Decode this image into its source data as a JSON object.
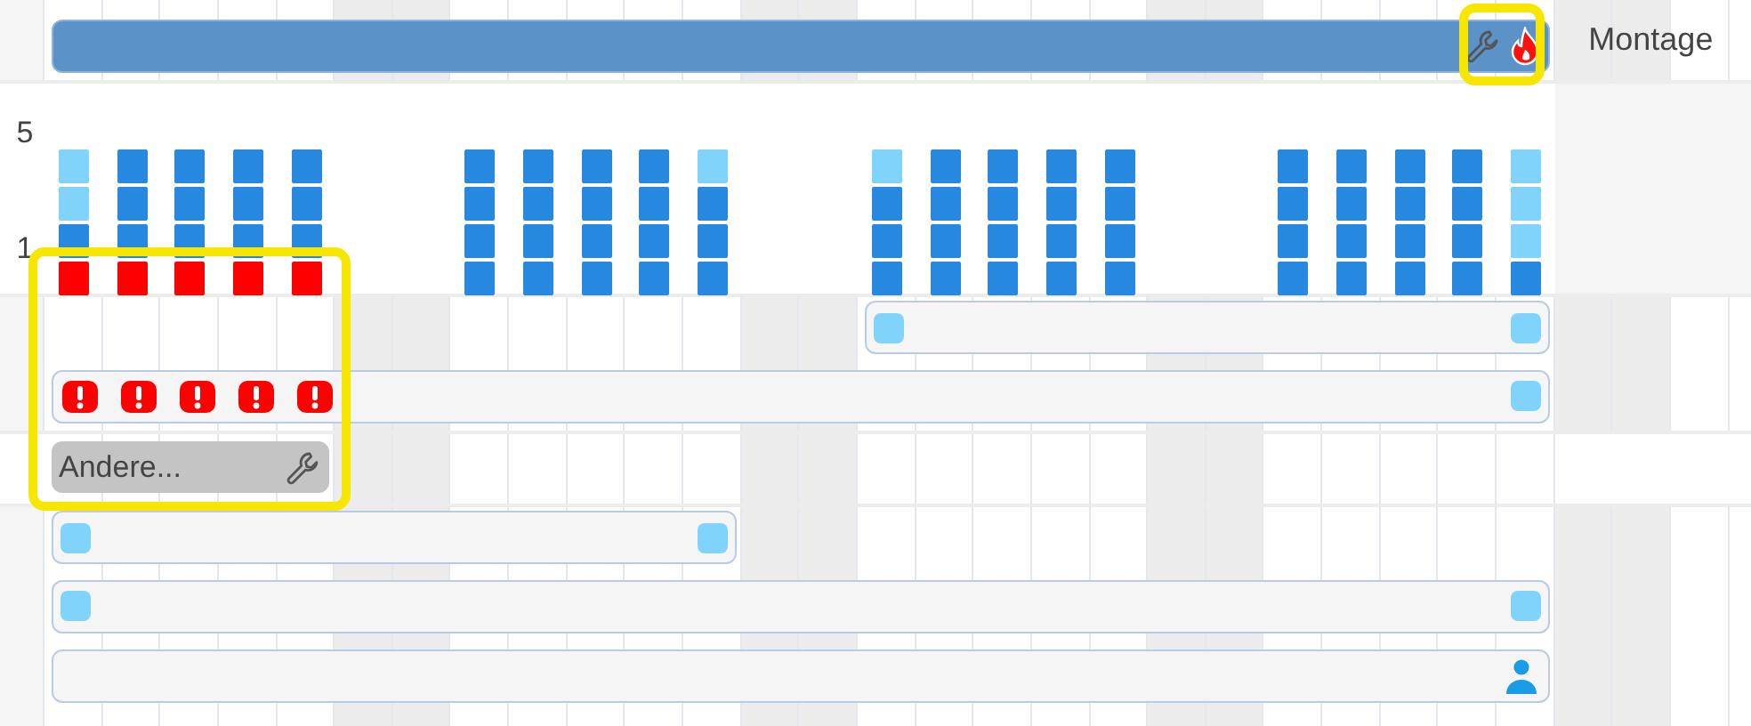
{
  "axis_labels": [
    "5",
    "1"
  ],
  "days": [
    {
      "weekend": false,
      "load": [
        {
          "kind": "free"
        },
        {
          "kind": "free"
        },
        {
          "kind": "booked"
        },
        {
          "kind": "over"
        }
      ]
    },
    {
      "weekend": false,
      "load": [
        {
          "kind": "booked"
        },
        {
          "kind": "booked"
        },
        {
          "kind": "booked"
        },
        {
          "kind": "over"
        }
      ]
    },
    {
      "weekend": false,
      "load": [
        {
          "kind": "booked"
        },
        {
          "kind": "booked"
        },
        {
          "kind": "booked"
        },
        {
          "kind": "over"
        }
      ]
    },
    {
      "weekend": false,
      "load": [
        {
          "kind": "booked"
        },
        {
          "kind": "booked"
        },
        {
          "kind": "booked"
        },
        {
          "kind": "over"
        }
      ]
    },
    {
      "weekend": false,
      "load": [
        {
          "kind": "booked"
        },
        {
          "kind": "booked"
        },
        {
          "kind": "booked"
        },
        {
          "kind": "over"
        }
      ]
    },
    {
      "weekend": true
    },
    {
      "weekend": true
    },
    {
      "weekend": false,
      "load": [
        {
          "kind": "booked"
        },
        {
          "kind": "booked"
        },
        {
          "kind": "booked"
        },
        {
          "kind": "booked"
        }
      ]
    },
    {
      "weekend": false,
      "load": [
        {
          "kind": "booked"
        },
        {
          "kind": "booked"
        },
        {
          "kind": "booked"
        },
        {
          "kind": "booked"
        }
      ]
    },
    {
      "weekend": false,
      "load": [
        {
          "kind": "booked"
        },
        {
          "kind": "booked"
        },
        {
          "kind": "booked"
        },
        {
          "kind": "booked"
        }
      ]
    },
    {
      "weekend": false,
      "load": [
        {
          "kind": "booked"
        },
        {
          "kind": "booked"
        },
        {
          "kind": "booked"
        },
        {
          "kind": "booked"
        }
      ]
    },
    {
      "weekend": false,
      "load": [
        {
          "kind": "free"
        },
        {
          "kind": "booked"
        },
        {
          "kind": "booked"
        },
        {
          "kind": "booked"
        }
      ]
    },
    {
      "weekend": true
    },
    {
      "weekend": true
    },
    {
      "weekend": false,
      "load": [
        {
          "kind": "free"
        },
        {
          "kind": "booked"
        },
        {
          "kind": "booked"
        },
        {
          "kind": "booked"
        }
      ]
    },
    {
      "weekend": false,
      "load": [
        {
          "kind": "booked"
        },
        {
          "kind": "booked"
        },
        {
          "kind": "booked"
        },
        {
          "kind": "booked"
        }
      ]
    },
    {
      "weekend": false,
      "load": [
        {
          "kind": "booked"
        },
        {
          "kind": "booked"
        },
        {
          "kind": "booked"
        },
        {
          "kind": "booked"
        }
      ]
    },
    {
      "weekend": false,
      "load": [
        {
          "kind": "booked"
        },
        {
          "kind": "booked"
        },
        {
          "kind": "booked"
        },
        {
          "kind": "booked"
        }
      ]
    },
    {
      "weekend": false,
      "load": [
        {
          "kind": "booked"
        },
        {
          "kind": "booked"
        },
        {
          "kind": "booked"
        },
        {
          "kind": "booked"
        }
      ]
    },
    {
      "weekend": true
    },
    {
      "weekend": true
    },
    {
      "weekend": false,
      "load": [
        {
          "kind": "booked"
        },
        {
          "kind": "booked"
        },
        {
          "kind": "booked"
        },
        {
          "kind": "booked"
        }
      ]
    },
    {
      "weekend": false,
      "load": [
        {
          "kind": "booked"
        },
        {
          "kind": "booked"
        },
        {
          "kind": "booked"
        },
        {
          "kind": "booked"
        }
      ]
    },
    {
      "weekend": false,
      "load": [
        {
          "kind": "booked"
        },
        {
          "kind": "booked"
        },
        {
          "kind": "booked"
        },
        {
          "kind": "booked"
        }
      ]
    },
    {
      "weekend": false,
      "load": [
        {
          "kind": "booked"
        },
        {
          "kind": "booked"
        },
        {
          "kind": "booked"
        },
        {
          "kind": "booked"
        }
      ]
    },
    {
      "weekend": false,
      "load": [
        {
          "kind": "free"
        },
        {
          "kind": "free"
        },
        {
          "kind": "free"
        },
        {
          "kind": "booked"
        }
      ]
    },
    {
      "weekend": true
    },
    {
      "weekend": true
    },
    {
      "weekend": false
    },
    {
      "weekend": false
    }
  ],
  "resource_label": "Montage",
  "lanes": [
    {
      "kind": "summary",
      "end_markers": [
        {
          "kind": "tool"
        },
        {
          "kind": "fire"
        }
      ]
    },
    {
      "kind": "task",
      "start_markers": [
        {
          "kind": "endpoint"
        }
      ],
      "end_markers": [
        {
          "kind": "endpoint"
        }
      ]
    },
    {
      "kind": "task",
      "start_markers": [
        {
          "kind": "alert"
        },
        {
          "kind": "alert"
        },
        {
          "kind": "alert"
        },
        {
          "kind": "alert"
        },
        {
          "kind": "alert"
        }
      ],
      "end_markers": [
        {
          "kind": "endpoint"
        }
      ]
    },
    {
      "kind": "other",
      "label": "Andere...",
      "end_markers": [
        {
          "kind": "tool"
        }
      ]
    },
    {
      "kind": "task",
      "start_markers": [
        {
          "kind": "endpoint"
        }
      ],
      "end_markers": [
        {
          "kind": "endpoint"
        }
      ]
    },
    {
      "kind": "task",
      "start_markers": [
        {
          "kind": "endpoint"
        }
      ],
      "end_markers": [
        {
          "kind": "endpoint"
        }
      ]
    },
    {
      "kind": "task",
      "end_markers": [
        {
          "kind": "person"
        }
      ]
    }
  ],
  "annotations": [
    {
      "kind": "highlight"
    },
    {
      "kind": "highlight"
    }
  ]
}
